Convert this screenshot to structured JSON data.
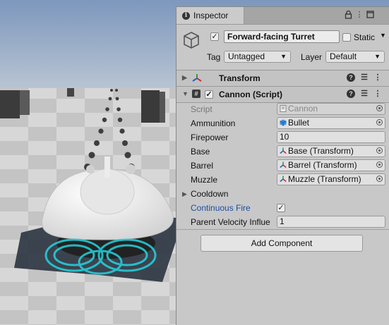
{
  "inspector": {
    "tab_label": "Inspector",
    "icons": {
      "tab": "info-icon",
      "lock": "lock-icon",
      "menu": "kebab-icon",
      "maximize": "maximize-icon"
    },
    "object": {
      "active": true,
      "name": "Forward-facing Turret",
      "static_label": "Static",
      "static_checked": false,
      "tag_label": "Tag",
      "tag_value": "Untagged",
      "layer_label": "Layer",
      "layer_value": "Default"
    },
    "components": [
      {
        "title": "Transform",
        "icon": "transform-icon",
        "expanded": false
      },
      {
        "title": "Cannon (Script)",
        "icon": "script-icon",
        "expanded": true,
        "enabled": true
      }
    ],
    "cannon": {
      "script_label": "Script",
      "script_value": "Cannon",
      "ammunition_label": "Ammunition",
      "ammunition_value": "Bullet",
      "firepower_label": "Firepower",
      "firepower_value": "10",
      "base_label": "Base",
      "base_value": "Base (Transform)",
      "barrel_label": "Barrel",
      "barrel_value": "Barrel (Transform)",
      "muzzle_label": "Muzzle",
      "muzzle_value": "Muzzle (Transform)",
      "cooldown_label": "Cooldown",
      "continuous_fire_label": "Continuous Fire",
      "continuous_fire_checked": true,
      "parent_velocity_label": "Parent Velocity Influe",
      "parent_velocity_value": "1"
    },
    "add_component_label": "Add Component"
  },
  "colors": {
    "panel_bg": "#c8c8c8",
    "highlight_label": "#1d4ea0",
    "ring_glow": "#25d3df",
    "sky": "#8ea6c7"
  }
}
